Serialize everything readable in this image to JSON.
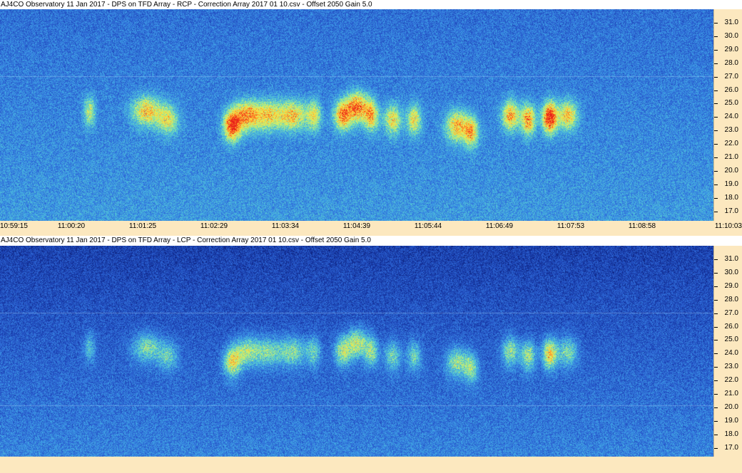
{
  "panels": [
    {
      "title": "AJ4CO Observatory 11 Jan 2017  -  DPS on TFD Array  -  RCP  -  Correction Array 2017 01 10.csv  -  Offset 2050  Gain 5.0",
      "polarization": "RCP",
      "background_intensity": "bright"
    },
    {
      "title": "AJ4CO Observatory 11 Jan 2017  -  DPS on TFD Array  -  LCP  -  Correction Array 2017 01 10.csv  -  Offset 2050  Gain 5.0",
      "polarization": "LCP",
      "background_intensity": "dark"
    }
  ],
  "y_axis": {
    "ticks": [
      "31.0",
      "30.0",
      "29.0",
      "28.0",
      "27.0",
      "26.0",
      "25.0",
      "24.0",
      "23.0",
      "22.0",
      "21.0",
      "20.0",
      "19.0",
      "18.0",
      "17.0"
    ]
  },
  "x_axis": {
    "ticks": [
      "10:59:15",
      "11:00:20",
      "11:01:25",
      "11:02:29",
      "11:03:34",
      "11:04:39",
      "11:05:44",
      "11:06:49",
      "11:07:53",
      "11:08:58",
      "11:10:03"
    ]
  },
  "colors": {
    "axis_background": "#fce8bf",
    "colormap": [
      "#0a1a6e",
      "#1a3fb0",
      "#2f6ad8",
      "#3fa2e6",
      "#5fd6c8",
      "#c8f070",
      "#ffe040",
      "#ff7a20",
      "#e8201a"
    ]
  }
}
